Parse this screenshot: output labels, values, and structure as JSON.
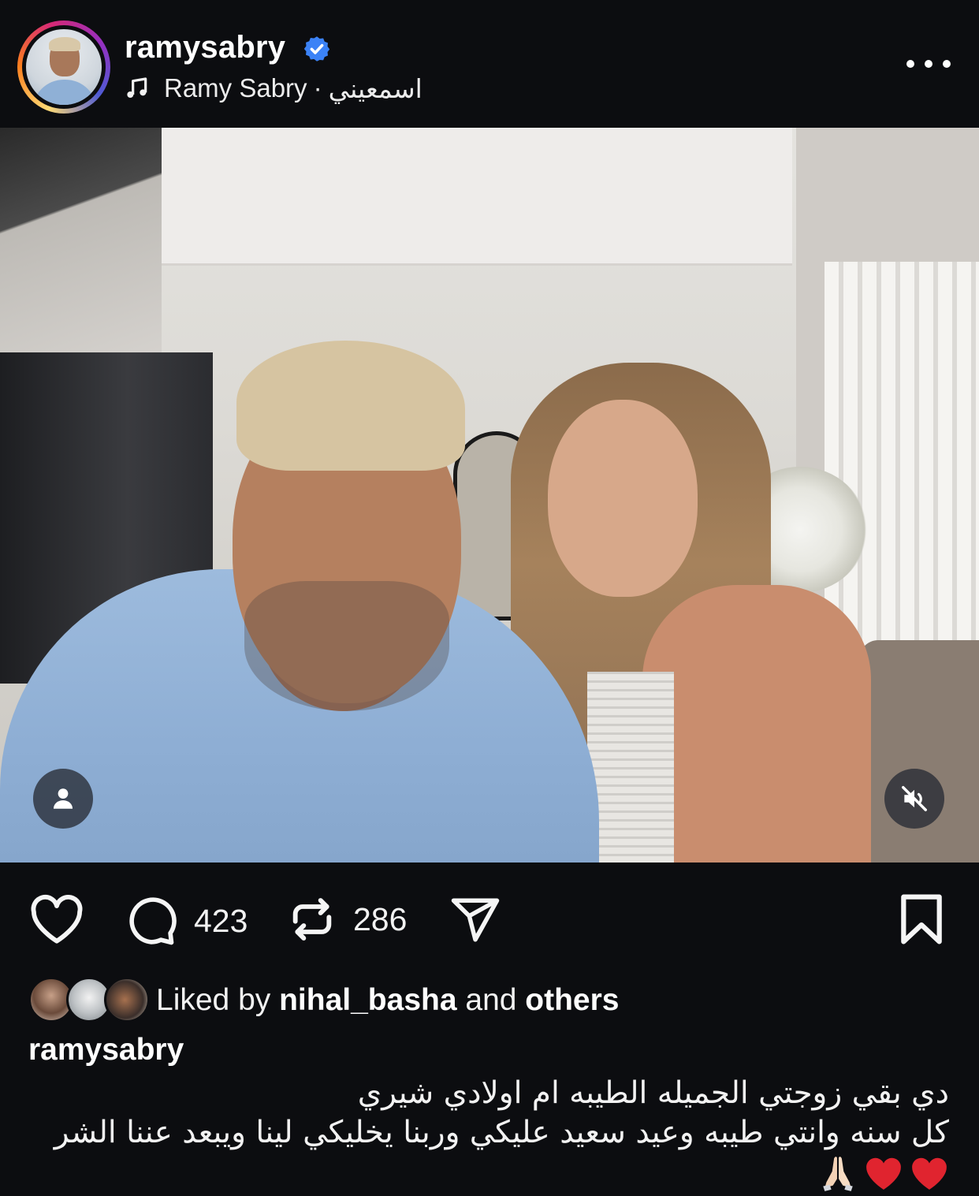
{
  "post": {
    "username": "ramysabry",
    "verified": true,
    "audio": {
      "artist": "Ramy Sabry",
      "separator": "·",
      "track": "اسمعيني"
    },
    "more_icon": "ellipsis-icon"
  },
  "media": {
    "type": "video",
    "tag_people_icon": "person-icon",
    "mute_icon": "muted-speaker-icon"
  },
  "actions": {
    "like_icon": "heart-outline-icon",
    "comment_icon": "comment-bubble-icon",
    "comments_count": "423",
    "repost_icon": "repost-icon",
    "reposts_count": "286",
    "share_icon": "paper-plane-icon",
    "save_icon": "bookmark-icon"
  },
  "likes": {
    "prefix": "Liked by",
    "user": "nihal_basha",
    "joiner": "and",
    "others": "others"
  },
  "caption": {
    "username": "ramysabry",
    "lines": [
      "دي بقي زوجتي الجميله الطيبه ام اولادي شيري",
      "كل سنه وانتي طيبه وعيد سعيد عليكي وربنا يخليكي لينا ويبعد عننا الشر"
    ],
    "emojis": [
      "heart-emoji",
      "heart-emoji",
      "folded-hands-emoji"
    ]
  },
  "colors": {
    "background": "#0c0d10",
    "verified_badge": "#3b82f6",
    "heart_emoji": "#e0242f"
  }
}
